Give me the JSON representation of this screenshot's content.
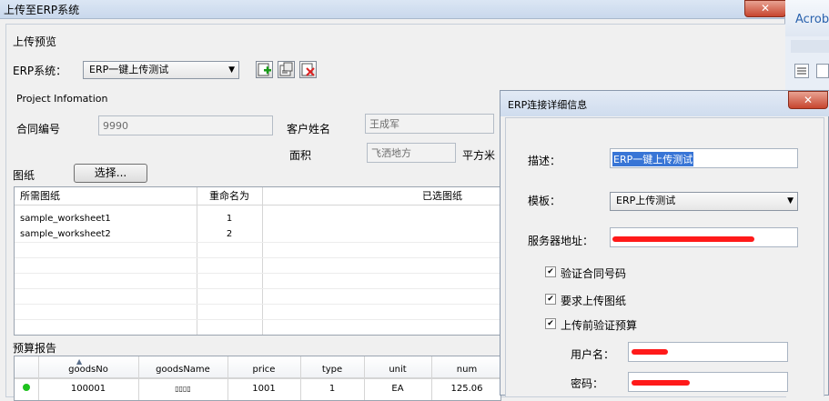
{
  "main_window": {
    "title": "上传至ERP系统",
    "close_glyph": "✕",
    "section_title": "上传预览",
    "erp_label": "ERP系统：",
    "erp_selected": "ERP一键上传测试",
    "project_info_title": "Project Infomation",
    "contract_no_label": "合同编号",
    "contract_no_value": "9990",
    "customer_label": "客户姓名",
    "customer_value": "王成军",
    "area_label": "面积",
    "area_value": "飞洒地方",
    "area_unit": "平方米",
    "drawings_label": "图纸",
    "choose_button": "选择...",
    "drawings_table": {
      "headers": [
        "所需图纸",
        "重命名为",
        "已选图纸"
      ],
      "rows": [
        {
          "name": "sample_worksheet1",
          "rename": "1"
        },
        {
          "name": "sample_worksheet2",
          "rename": "2"
        }
      ]
    },
    "budget_label": "预算报告",
    "budget_table": {
      "headers": [
        "goodsNo",
        "goodsName",
        "price",
        "type",
        "unit",
        "num"
      ],
      "rows": [
        {
          "goodsNo": "100001",
          "goodsName": "▯▯▯▯",
          "price": "1001",
          "type": "1",
          "unit": "EA",
          "num": "125.06"
        }
      ]
    }
  },
  "background_app": {
    "label": "Acrob"
  },
  "dialog": {
    "title": "ERP连接详细信息",
    "close_glyph": "✕",
    "desc_label": "描述：",
    "desc_value": "ERP一键上传测试",
    "template_label": "模板：",
    "template_selected": "ERP上传测试",
    "server_label": "服务器地址：",
    "check_contract_label": "验证合同号码",
    "check_upload_label": "要求上传图纸",
    "check_budget_label": "上传前验证预算",
    "username_label": "用户名：",
    "password_label": "密码："
  },
  "colors": {
    "redaction": "#ff1a1a",
    "selection": "#3875d6",
    "status_dot": "#1ec21e"
  },
  "icons": [
    "add-icon",
    "edit-icon",
    "delete-icon",
    "checkbox-check-icon",
    "sort-up-icon"
  ]
}
